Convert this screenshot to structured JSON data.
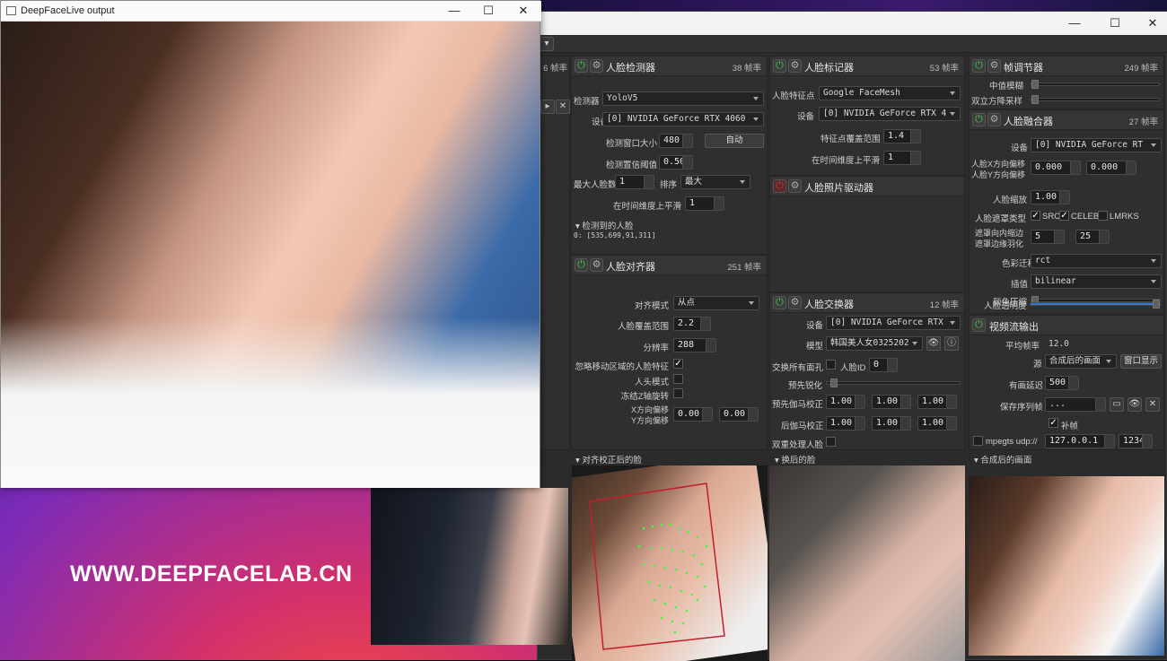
{
  "output_window": {
    "title": "DeepFaceLive output",
    "buttons": [
      "—",
      "☐",
      "✕"
    ]
  },
  "watermark": "WWW.DEEPFACELAB.CN",
  "main_window": {
    "buttons": [
      "—",
      "☐",
      "✕"
    ]
  },
  "left_partial": {
    "fps": "6 帧率"
  },
  "face_detector": {
    "title": "人脸检测器",
    "fps": "38 帧率",
    "detector_label": "检测器",
    "detector_value": "YoloV5",
    "device_label": "设备",
    "device_value": "[0] NVIDIA GeForce RTX 4060",
    "window_size_label": "检测窗口大小",
    "window_size_value": "480",
    "auto_button": "自动",
    "threshold_label": "检测置信阈值",
    "threshold_value": "0.50",
    "max_faces_label": "最大人脸数",
    "max_faces_value": "1",
    "sort_label": "排序",
    "sort_value": "最大",
    "temporal_label": "在时间维度上平滑",
    "temporal_value": "1",
    "detected_label": "检测到的人脸",
    "detected_value": "0: [535,699,91,311]"
  },
  "face_marker": {
    "title": "人脸标记器",
    "fps": "53 帧率",
    "type_label": "人脸特征点",
    "type_value": "Google FaceMesh",
    "device_label": "设备",
    "device_value": "[0] NVIDIA GeForce RTX 4",
    "coverage_label": "特征点覆盖范围",
    "coverage_value": "1.4",
    "temporal_label": "在时间维度上平滑",
    "temporal_value": "1"
  },
  "frame_adjuster": {
    "title": "帧调节器",
    "fps": "249 帧率",
    "median_label": "中值模糊",
    "bilateral_label": "双立方降采样"
  },
  "face_merger": {
    "title": "人脸融合器",
    "fps": "27 帧率",
    "device_label": "设备",
    "device_value": "[0] NVIDIA GeForce RT",
    "offset_label_1": "人脸X方向偏移",
    "offset_label_2": "人脸Y方向偏移",
    "x_offset": "0.000",
    "y_offset": "0.000",
    "scale_label": "人脸缩放",
    "scale_value": "1.00",
    "mask_label": "人脸遮罩类型",
    "mask_src": "SRC",
    "mask_celeb": "CELEB",
    "mask_lmrks": "LMRKS",
    "erode_label": "遮罩向内缩边",
    "blur_label": "遮罩边缘羽化",
    "erode_value": "5",
    "blur_value": "25",
    "color_transfer_label": "色彩迁移",
    "color_transfer_value": "rct",
    "interp_label": "插值",
    "interp_value": "bilinear",
    "color_compress_label": "颜色压缩",
    "opacity_label": "人脸透明度"
  },
  "face_animator": {
    "title": "人脸照片驱动器"
  },
  "face_aligner": {
    "title": "人脸对齐器",
    "fps": "251 帧率",
    "mode_label": "对齐模式",
    "mode_value": "从点",
    "coverage_label": "人脸覆盖范围",
    "coverage_value": "2.2",
    "resolution_label": "分辨率",
    "resolution_value": "288",
    "exclude_moving_label": "忽略移动区域的人脸特征",
    "head_mode_label": "人头模式",
    "z_rotation_label": "冻结Z轴旋转",
    "x_offset_label": "X方向偏移",
    "y_offset_label": "Y方向偏移",
    "x_offset_value": "0.00",
    "y_offset_value": "0.00"
  },
  "face_swapper": {
    "title": "人脸交换器",
    "fps": "12 帧率",
    "device_label": "设备",
    "device_value": "[0] NVIDIA GeForce RTX",
    "model_label": "模型",
    "model_value": "韩国美人女0325202",
    "swap_all_label": "交换所有面孔",
    "face_id_label": "人脸ID",
    "face_id_value": "0",
    "pre_sharpen_label": "预先锐化",
    "pre_gamma_label": "预先伽马校正",
    "post_gamma_label": "后伽马校正",
    "gamma_values": [
      "1.00",
      "1.00",
      "1.00"
    ],
    "two_pass_label": "双重处理人脸"
  },
  "stream_output": {
    "title": "视频流输出",
    "avg_fps_label": "平均帧率",
    "avg_fps_value": "12.0",
    "source_label": "源",
    "source_value": "合成后的画面",
    "window_button": "窗口显示",
    "delay_label": "有画延迟",
    "delay_value": "500",
    "save_label": "保存序列帧",
    "save_value": "...",
    "fill_label": "补帧",
    "mpegts_label": "mpegts udp://",
    "ip_value": "127.0.0.1",
    "port_value": "1234"
  },
  "previews": {
    "aligned": "对齐校正后的脸",
    "swapped": "换后的脸",
    "merged": "合成后的画面"
  }
}
